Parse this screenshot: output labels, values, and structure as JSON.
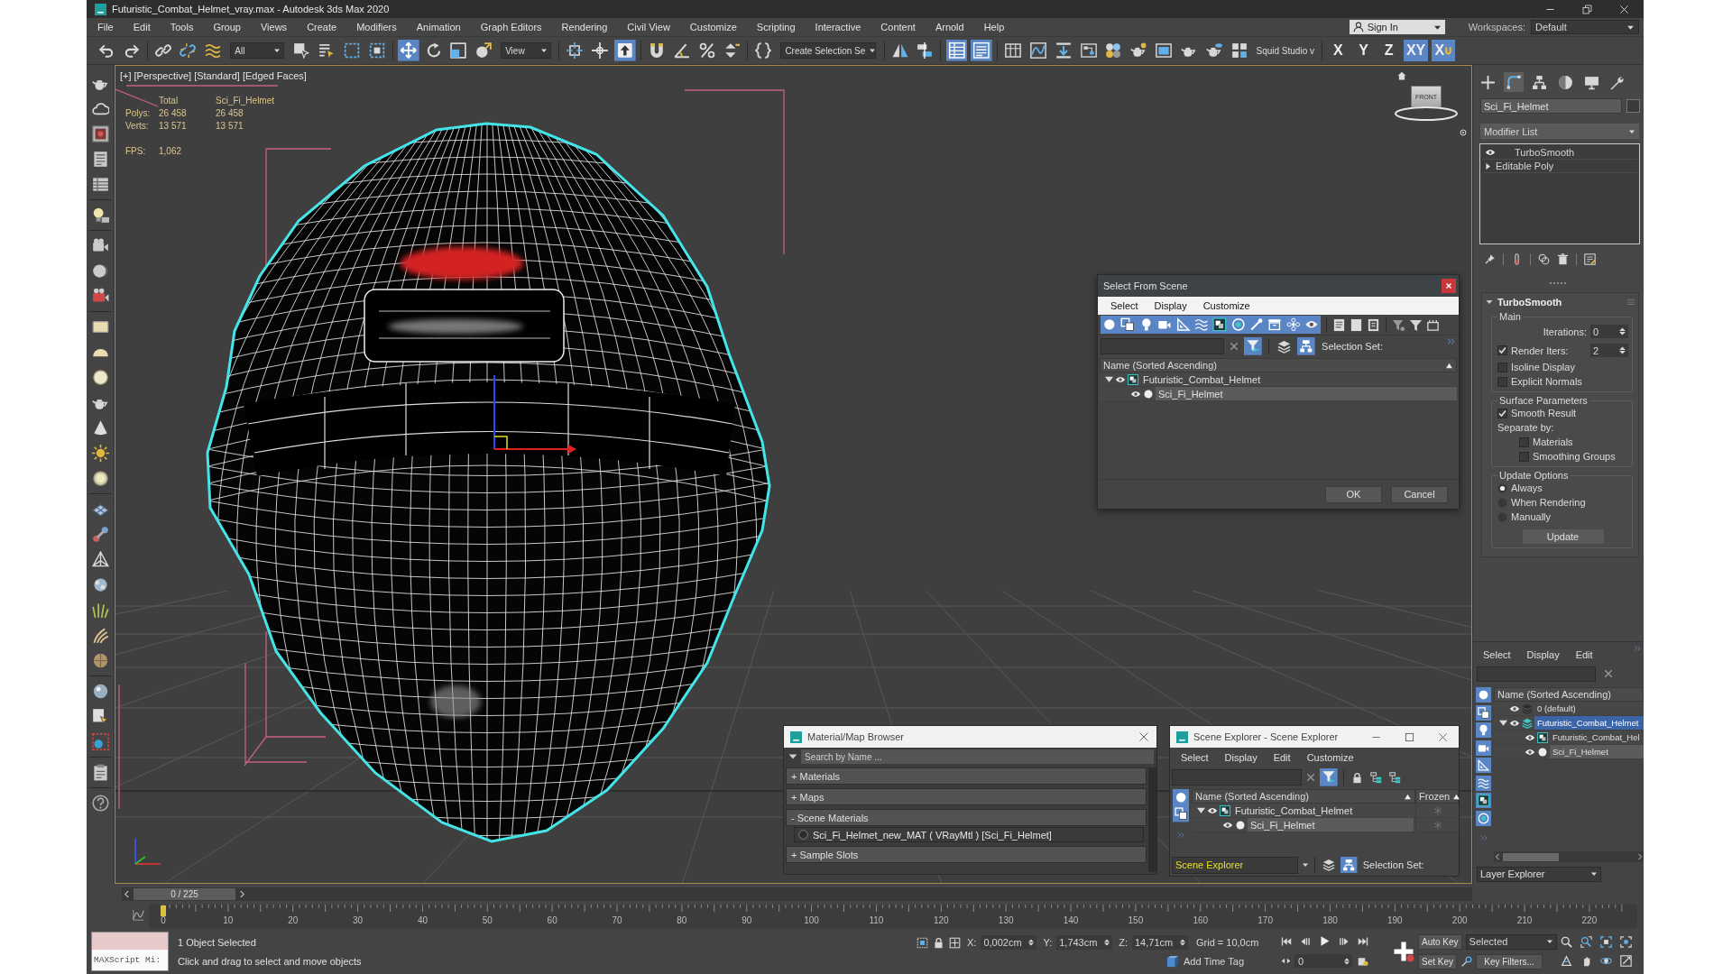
{
  "window": {
    "title": "Futuristic_Combat_Helmet_vray.max - Autodesk 3ds Max 2020"
  },
  "menu_bar": {
    "items": [
      "File",
      "Edit",
      "Tools",
      "Group",
      "Views",
      "Create",
      "Modifiers",
      "Animation",
      "Graph Editors",
      "Rendering",
      "Civil View",
      "Customize",
      "Scripting",
      "Interactive",
      "Content",
      "Arnold",
      "Help"
    ],
    "sign_in": "Sign In",
    "workspaces_label": "Workspaces:",
    "workspace": "Default"
  },
  "main_toolbar": {
    "buttons": [
      {
        "active": false
      },
      {
        "active": false
      },
      {
        "active": false
      },
      {
        "active": false
      },
      {
        "active": false
      },
      {
        "active": false
      },
      {
        "active": false
      },
      {
        "active": false
      },
      {
        "active": false
      },
      {
        "active": true
      },
      {
        "active": false
      },
      {
        "active": false
      },
      {
        "active": false
      },
      {
        "active": false
      },
      {
        "active": false
      },
      {
        "active": true
      },
      {
        "active": false
      },
      {
        "active": false
      },
      {
        "active": false
      },
      {
        "active": false
      },
      {
        "active": false
      },
      {
        "active": false
      },
      {
        "active": false
      },
      {
        "active": true
      },
      {
        "active": true
      },
      {
        "active": false
      },
      {
        "active": false
      },
      {
        "active": false
      },
      {
        "active": false
      },
      {
        "active": false
      },
      {
        "active": false
      },
      {
        "active": false
      },
      {
        "active": false
      },
      {
        "active": false
      },
      {
        "active": false
      }
    ],
    "fields": [
      {
        "kind": "dropdown",
        "label": "All"
      },
      {
        "kind": "dropdown",
        "label": "View"
      },
      {
        "kind": "dropdown",
        "label": "Create Selection Se"
      },
      {
        "kind": "label",
        "label": "Squid Studio v"
      }
    ],
    "axis_buttons": [
      {
        "kind": "axis",
        "label": "X",
        "active": false
      },
      {
        "kind": "axis",
        "label": "Y",
        "active": false
      },
      {
        "kind": "axis",
        "label": "Z",
        "active": false
      },
      {
        "kind": "axis",
        "label": "XY",
        "active": true
      },
      {
        "kind": "snap",
        "label": "X",
        "active": true
      }
    ]
  },
  "viewport": {
    "labels": [
      "[+]",
      "[Perspective]",
      "[Standard]",
      "[Edged Faces]"
    ],
    "stats": {
      "columns": [
        "Total",
        "Sci_Fi_Helmet"
      ],
      "rows": [
        {
          "label": "Polys:",
          "values": [
            "26 458",
            "26 458"
          ]
        },
        {
          "label": "Verts:",
          "values": [
            "13 571",
            "13 571"
          ]
        }
      ],
      "fps_label": "FPS:",
      "fps": "1,062"
    },
    "viewcube": {
      "face": "FRONT"
    }
  },
  "select_from_scene": {
    "title": "Select From Scene",
    "menu": [
      "Select",
      "Display",
      "Customize"
    ],
    "filters": [
      {
        "on": true
      },
      {
        "on": true
      },
      {
        "on": true
      },
      {
        "on": true
      },
      {
        "on": true
      },
      {
        "on": true
      },
      {
        "on": true
      },
      {
        "on": true
      },
      {
        "on": true
      },
      {
        "on": true
      },
      {
        "on": true
      },
      {
        "on": true
      }
    ],
    "toggles": [
      {
        "on": true
      },
      {
        "on": false
      },
      {
        "on": true
      }
    ],
    "selection_set_label": "Selection Set:",
    "column": "Name (Sorted Ascending)",
    "tree": [
      {
        "kind": "group",
        "name": "Futuristic_Combat_Helmet",
        "expanded": true,
        "selected": false,
        "children": [
          {
            "kind": "object",
            "name": "Sci_Fi_Helmet",
            "selected": true
          }
        ]
      }
    ],
    "buttons": [
      "OK",
      "Cancel"
    ]
  },
  "material_browser": {
    "title": "Material/Map Browser",
    "search_placeholder": "Search by Name ...",
    "sections": [
      {
        "marker": "+",
        "label": "Materials"
      },
      {
        "marker": "+",
        "label": "Maps"
      },
      {
        "marker": "-",
        "label": "Scene Materials",
        "items": [
          "Sci_Fi_Helmet_new_MAT ( VRayMtl ) [Sci_Fi_Helmet]"
        ]
      },
      {
        "marker": "+",
        "label": "Sample Slots"
      }
    ]
  },
  "scene_explorer": {
    "title": "Scene Explorer - Scene Explorer",
    "menu": [
      "Select",
      "Display",
      "Edit",
      "Customize"
    ],
    "toggles": [
      {
        "on": true
      },
      {
        "on": false
      },
      {
        "on": false
      },
      {
        "on": false
      }
    ],
    "filters": [
      {
        "on": true
      },
      {
        "on": true
      }
    ],
    "columns": [
      "Name (Sorted Ascending)",
      "Frozen"
    ],
    "tree": [
      {
        "kind": "group",
        "name": "Futuristic_Combat_Helmet",
        "expanded": true,
        "selected": false,
        "frozen": false,
        "children": [
          {
            "kind": "object",
            "name": "Sci_Fi_Helmet",
            "selected": true,
            "frozen": false
          }
        ]
      }
    ],
    "explorer_name": "Scene Explorer",
    "bottom_toggles": [
      {
        "on": false
      },
      {
        "on": true
      }
    ],
    "selection_set_label": "Selection Set:"
  },
  "command_panel": {
    "tabs": [
      {
        "selected": false
      },
      {
        "selected": true
      },
      {
        "selected": false
      },
      {
        "selected": false
      },
      {
        "selected": false
      },
      {
        "selected": false
      }
    ],
    "object_name": "Sci_Fi_Helmet",
    "modifier_list": "Modifier List",
    "stack": [
      {
        "kind": "modifier",
        "name": "TurboSmooth"
      },
      {
        "kind": "base",
        "name": "Editable Poly",
        "expanded": false
      }
    ]
  },
  "rollout": {
    "title": "TurboSmooth",
    "groups": [
      {
        "title": "Main",
        "controls": [
          {
            "kind": "spinner",
            "label": "Iterations:",
            "value": "0"
          },
          {
            "kind": "check_spinner",
            "label": "Render Iters:",
            "checked": true,
            "value": "2"
          },
          {
            "kind": "checkbox",
            "label": "Isoline Display",
            "checked": false
          },
          {
            "kind": "checkbox",
            "label": "Explicit Normals",
            "checked": false
          }
        ]
      },
      {
        "title": "Surface Parameters",
        "controls": [
          {
            "kind": "checkbox",
            "label": "Smooth Result",
            "checked": true
          },
          {
            "kind": "label",
            "label": "Separate by:",
            "children": [
              {
                "kind": "checkbox",
                "label": "Materials",
                "checked": false
              },
              {
                "kind": "checkbox",
                "label": "Smoothing Groups",
                "checked": false
              }
            ]
          }
        ]
      },
      {
        "title": "Update Options",
        "controls": [
          {
            "kind": "radio",
            "label": "Always",
            "selected": true
          },
          {
            "kind": "radio",
            "label": "When Rendering",
            "selected": false
          },
          {
            "kind": "radio",
            "label": "Manually",
            "selected": false
          },
          {
            "kind": "button",
            "label": "Update"
          }
        ]
      }
    ]
  },
  "layer_explorer": {
    "menu": [
      "Select",
      "Display",
      "Edit"
    ],
    "filters": [
      {
        "on": true
      },
      {
        "on": true
      },
      {
        "on": true
      },
      {
        "on": true
      },
      {
        "on": true
      },
      {
        "on": true
      },
      {
        "on": true
      },
      {
        "on": true
      }
    ],
    "column": "Name (Sorted Ascending)",
    "tree": [
      {
        "kind": "layer",
        "name": "0 (default)",
        "selected": false,
        "active": false
      },
      {
        "kind": "layer",
        "name": "Futuristic_Combat_Helmet",
        "expanded": true,
        "selected": false,
        "active": true,
        "children": [
          {
            "kind": "group",
            "name": "Futuristic_Combat_Hel",
            "selected": false,
            "active": false
          },
          {
            "kind": "object",
            "name": "Sci_Fi_Helmet",
            "selected": true,
            "active": false
          }
        ]
      }
    ],
    "explorer_name": "Layer Explorer"
  },
  "time_slider": {
    "frame": "0 / 225",
    "level": 0
  },
  "trackbar": {
    "ticks": [
      "0",
      "10",
      "20",
      "30",
      "40",
      "50",
      "60",
      "70",
      "80",
      "90",
      "100",
      "110",
      "120",
      "130",
      "140",
      "150",
      "160",
      "170",
      "180",
      "190",
      "200",
      "210",
      "220"
    ]
  },
  "status_bar": {
    "listener": "MAXScript Mi:",
    "selection": "1 Object Selected",
    "prompt": "Click and drag to select and move objects",
    "coords": [
      {
        "label": "X:",
        "value": "0,002cm"
      },
      {
        "label": "Y:",
        "value": "1,743cm"
      },
      {
        "label": "Z:",
        "value": "14,71cm"
      }
    ],
    "grid": "Grid = 10,0cm",
    "time_tag": "Add Time Tag",
    "frame": "0",
    "auto_key": "Auto Key",
    "set_key": "Set Key",
    "key_mode": "Selected",
    "key_filters": "Key Filters..."
  }
}
